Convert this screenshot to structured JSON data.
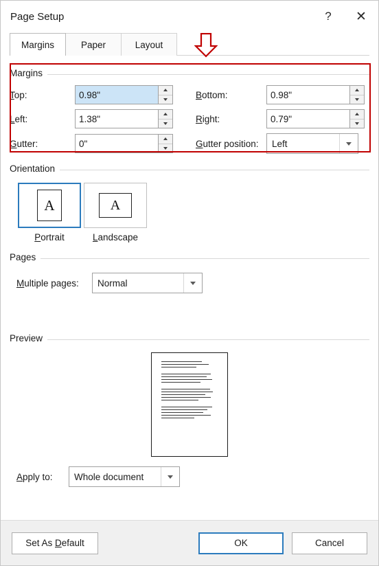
{
  "window": {
    "title": "Page Setup",
    "help_icon": "question-mark-icon",
    "help_glyph": "?",
    "close_icon": "close-icon",
    "close_glyph": "✕"
  },
  "tabs": [
    {
      "label": "Margins",
      "active": true
    },
    {
      "label": "Paper",
      "active": false
    },
    {
      "label": "Layout",
      "active": false
    }
  ],
  "annotation": {
    "color": "#c00000",
    "shape": "down-arrow"
  },
  "margins": {
    "group_label": "Margins",
    "top": {
      "label": "Top:",
      "label_pre": "T",
      "label_rest": "op:",
      "value": "0.98\"",
      "selected": true
    },
    "bottom": {
      "label": "Bottom:",
      "label_pre": "B",
      "label_rest": "ottom:",
      "value": "0.98\""
    },
    "left": {
      "label": "Left:",
      "label_pre": "L",
      "label_rest": "eft:",
      "value": "1.38\""
    },
    "right": {
      "label": "Right:",
      "label_pre": "R",
      "label_rest": "ight:",
      "value": "0.79\""
    },
    "gutter": {
      "label": "Gutter:",
      "label_pre": "G",
      "label_rest": "utter:",
      "value": "0\""
    },
    "gutter_position": {
      "label": "Gutter position:",
      "label_pre": "G",
      "label_rest": "utter position:",
      "value": "Left"
    }
  },
  "orientation": {
    "group_label": "Orientation",
    "portrait": {
      "label": "Portrait",
      "label_pre": "P",
      "label_rest": "ortrait",
      "glyph": "A",
      "selected": true
    },
    "landscape": {
      "label": "Landscape",
      "label_pre": "L",
      "label_rest": "andscape",
      "glyph": "A",
      "selected": false
    }
  },
  "pages": {
    "group_label": "Pages",
    "multiple_pages": {
      "label": "Multiple pages:",
      "label_pre": "M",
      "label_rest": "ultiple pages:",
      "value": "Normal"
    }
  },
  "preview": {
    "group_label": "Preview",
    "apply_to": {
      "label": "Apply to:",
      "label_pre": "A",
      "label_rest": "pply to:",
      "value": "Whole document"
    }
  },
  "footer": {
    "set_as_default": {
      "label": "Set As Default",
      "label_pre": "Set As ",
      "label_mid": "D",
      "label_rest": "efault"
    },
    "ok": "OK",
    "cancel": "Cancel"
  },
  "colors": {
    "accent": "#2b7bbd",
    "annotation": "#c00000",
    "selection": "#cce4f7"
  }
}
